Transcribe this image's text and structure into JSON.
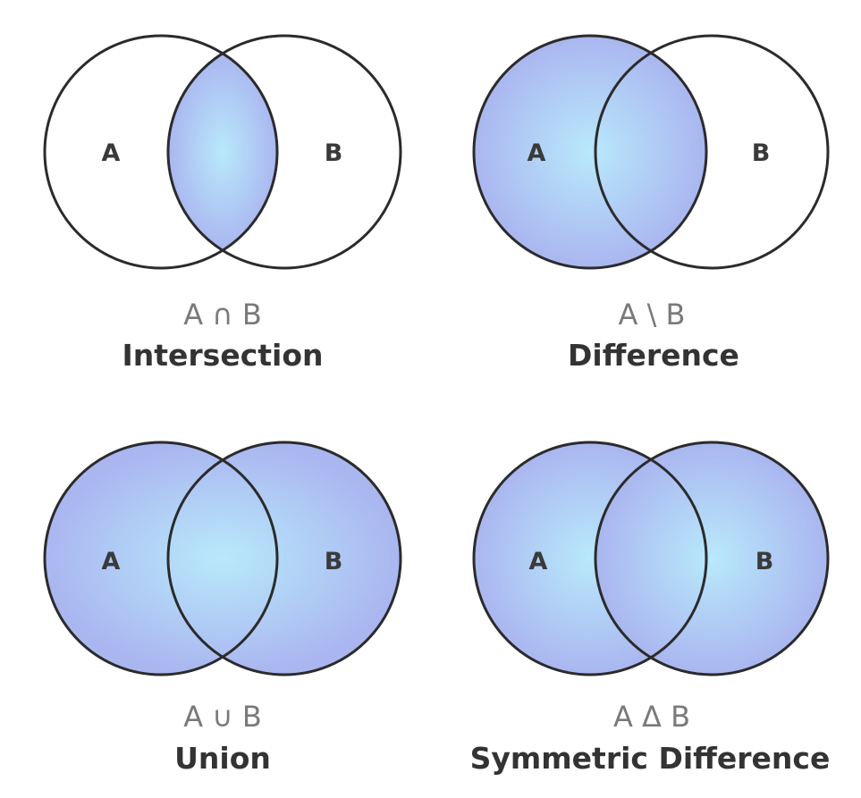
{
  "colors": {
    "fill_center": "#b8e9fb",
    "fill_edge": "#aab6f0",
    "outline": "#2b2b2b",
    "background": "#ffffff"
  },
  "panels": [
    {
      "id": "intersection",
      "shade": "intersection",
      "label_a": "A",
      "label_b": "B",
      "notation": "A ∩ B",
      "name": "Intersection"
    },
    {
      "id": "difference",
      "shade": "difference",
      "label_a": "A",
      "label_b": "B",
      "notation": "A \\ B",
      "name": "Difference"
    },
    {
      "id": "union",
      "shade": "union",
      "label_a": "A",
      "label_b": "B",
      "notation": "A ∪ B",
      "name": "Union"
    },
    {
      "id": "symmetric-difference",
      "shade": "symmetric",
      "label_a": "A",
      "label_b": "B",
      "notation": "A Δ B",
      "name": "Symmetric Difference"
    }
  ]
}
